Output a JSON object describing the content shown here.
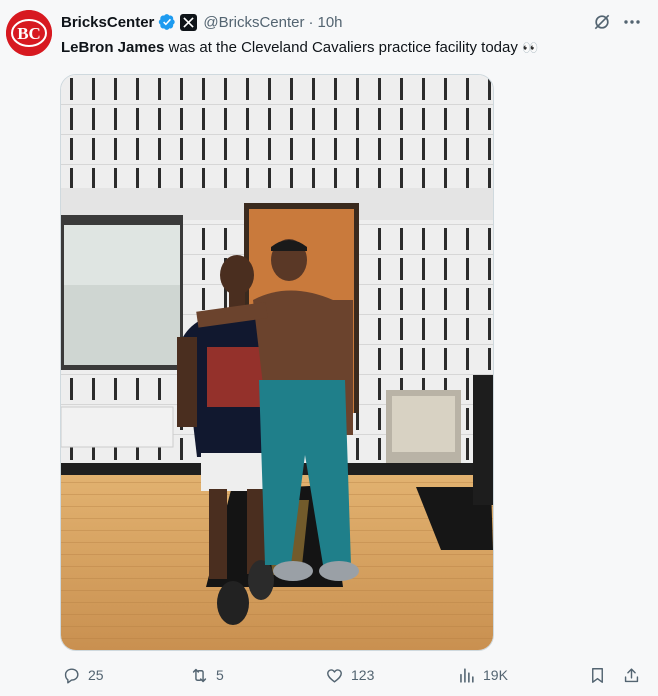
{
  "tweet": {
    "display_name": "BricksCenter",
    "handle": "@BricksCenter",
    "separator": "·",
    "time": "10h",
    "text_bold": "LeBron James",
    "text_rest": " was at the Cleveland Cavaliers practice facility today",
    "text_emoji": "👀",
    "avatar_letters": "BC"
  },
  "icons": {
    "verified": "verified-badge-icon",
    "affiliate": "x-affiliate-icon",
    "grok": "grok-icon",
    "more": "more-icon",
    "reply": "reply-icon",
    "retweet": "retweet-icon",
    "like": "like-icon",
    "views": "views-icon",
    "bookmark": "bookmark-icon",
    "share": "share-icon"
  },
  "actions": {
    "replies": "25",
    "retweets": "5",
    "likes": "123",
    "views": "19K"
  },
  "colors": {
    "accent": "#1d9bf0",
    "secondary_text": "#536471",
    "brand_red": "#d71920"
  }
}
